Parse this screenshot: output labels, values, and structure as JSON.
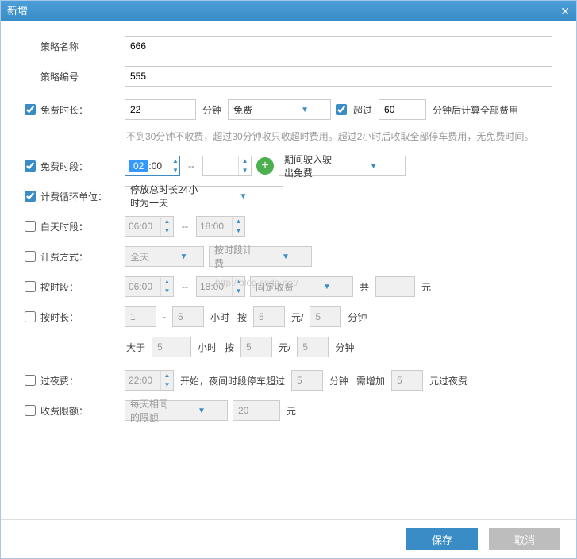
{
  "titlebar": {
    "title": "新增",
    "close": "✕"
  },
  "form": {
    "name_label": "策略名称",
    "name_value": "666",
    "code_label": "策略编号",
    "code_value": "555",
    "free_duration": {
      "label": "免费时长：",
      "value": "22",
      "unit": "分钟",
      "select": "免费",
      "over_label": "超过",
      "over_value": "60",
      "over_suffix": "分钟后计算全部费用"
    },
    "hint": "不到30分钟不收费，超过30分钟收只收超时费用。超过2小时后收取全部停车费用，无免费时间。",
    "free_period": {
      "label": "免费时段：",
      "from": "02:00",
      "to": "",
      "select": "期间驶入驶出免费"
    },
    "cycle": {
      "label": "计费循环单位：",
      "select": "停放总时长24小时为一天"
    },
    "day_period": {
      "label": "白天时段：",
      "from": "06:00",
      "to": "18:00"
    },
    "charge_mode": {
      "label": "计费方式：",
      "scope": "全天",
      "mode": "按时段计费"
    },
    "by_period": {
      "label": "按时段：",
      "from": "06:00",
      "to": "18:00",
      "type": "固定收费",
      "gong": "共",
      "amount": "",
      "yuan": "元"
    },
    "by_duration": {
      "label": "按时长：",
      "line1": {
        "from": "1",
        "dash": "-",
        "to": "5",
        "hour": "小时",
        "per": "按",
        "price": "5",
        "yuan_per": "元/",
        "per_val": "5",
        "unit": "分钟"
      },
      "line2": {
        "gt": "大于",
        "val": "5",
        "hour": "小时",
        "per": "按",
        "price": "5",
        "yuan_per": "元/",
        "per_val": "5",
        "unit": "分钟"
      }
    },
    "night_fee": {
      "label": "过夜费：",
      "start": "22:00",
      "text1": "开始，夜间时段停车超过",
      "min": "5",
      "text2": "分钟",
      "text3": "需增加",
      "amt": "5",
      "text4": "元过夜费"
    },
    "limit": {
      "label": "收费限额：",
      "select": "每天相同的限额",
      "value": "20",
      "yuan": "元"
    }
  },
  "footer": {
    "save": "保存",
    "cancel": "取消"
  },
  "watermark": "http://blog.csdn.net/"
}
